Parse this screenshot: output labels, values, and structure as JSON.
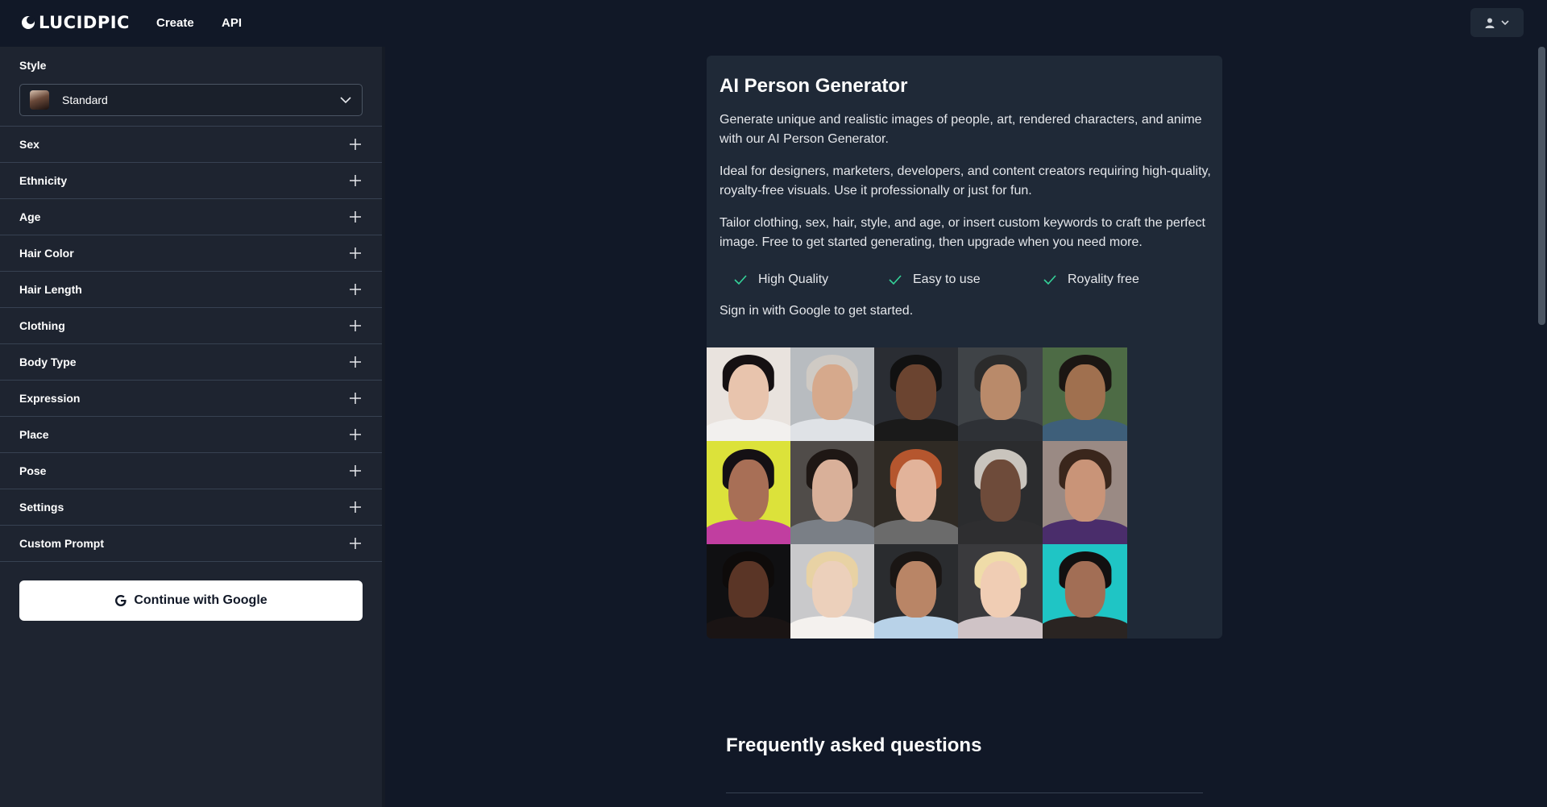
{
  "header": {
    "logo_text": "LUCIDPIC",
    "nav": [
      {
        "label": "Create"
      },
      {
        "label": "API"
      }
    ],
    "user_icon": "user-icon",
    "menu_icon": "chevron-down-icon"
  },
  "sidebar": {
    "style_label": "Style",
    "style_value": "Standard",
    "sections": [
      {
        "label": "Sex"
      },
      {
        "label": "Ethnicity"
      },
      {
        "label": "Age"
      },
      {
        "label": "Hair Color"
      },
      {
        "label": "Hair Length"
      },
      {
        "label": "Clothing"
      },
      {
        "label": "Body Type"
      },
      {
        "label": "Expression"
      },
      {
        "label": "Place"
      },
      {
        "label": "Pose"
      },
      {
        "label": "Settings"
      },
      {
        "label": "Custom Prompt"
      }
    ],
    "google_button": "Continue with Google"
  },
  "main": {
    "title": "AI Person Generator",
    "paragraphs": [
      "Generate unique and realistic images of people, art, rendered characters, and anime with our AI Person Generator.",
      "Ideal for designers, marketers, developers, and content creators requiring high-quality, royalty-free visuals. Use it professionally or just for fun.",
      "Tailor clothing, sex, hair, style, and age, or insert custom keywords to craft the perfect image. Free to get started generating, then upgrade when you need more."
    ],
    "features": [
      {
        "label": "High Quality"
      },
      {
        "label": "Easy to use"
      },
      {
        "label": "Royality free"
      }
    ],
    "signin_text": "Sign in with Google to get started."
  },
  "faq": {
    "title": "Frequently asked questions"
  },
  "colors": {
    "background": "#111827",
    "sidebar": "#1e2430",
    "card": "#1f2937",
    "check": "#34d399"
  }
}
